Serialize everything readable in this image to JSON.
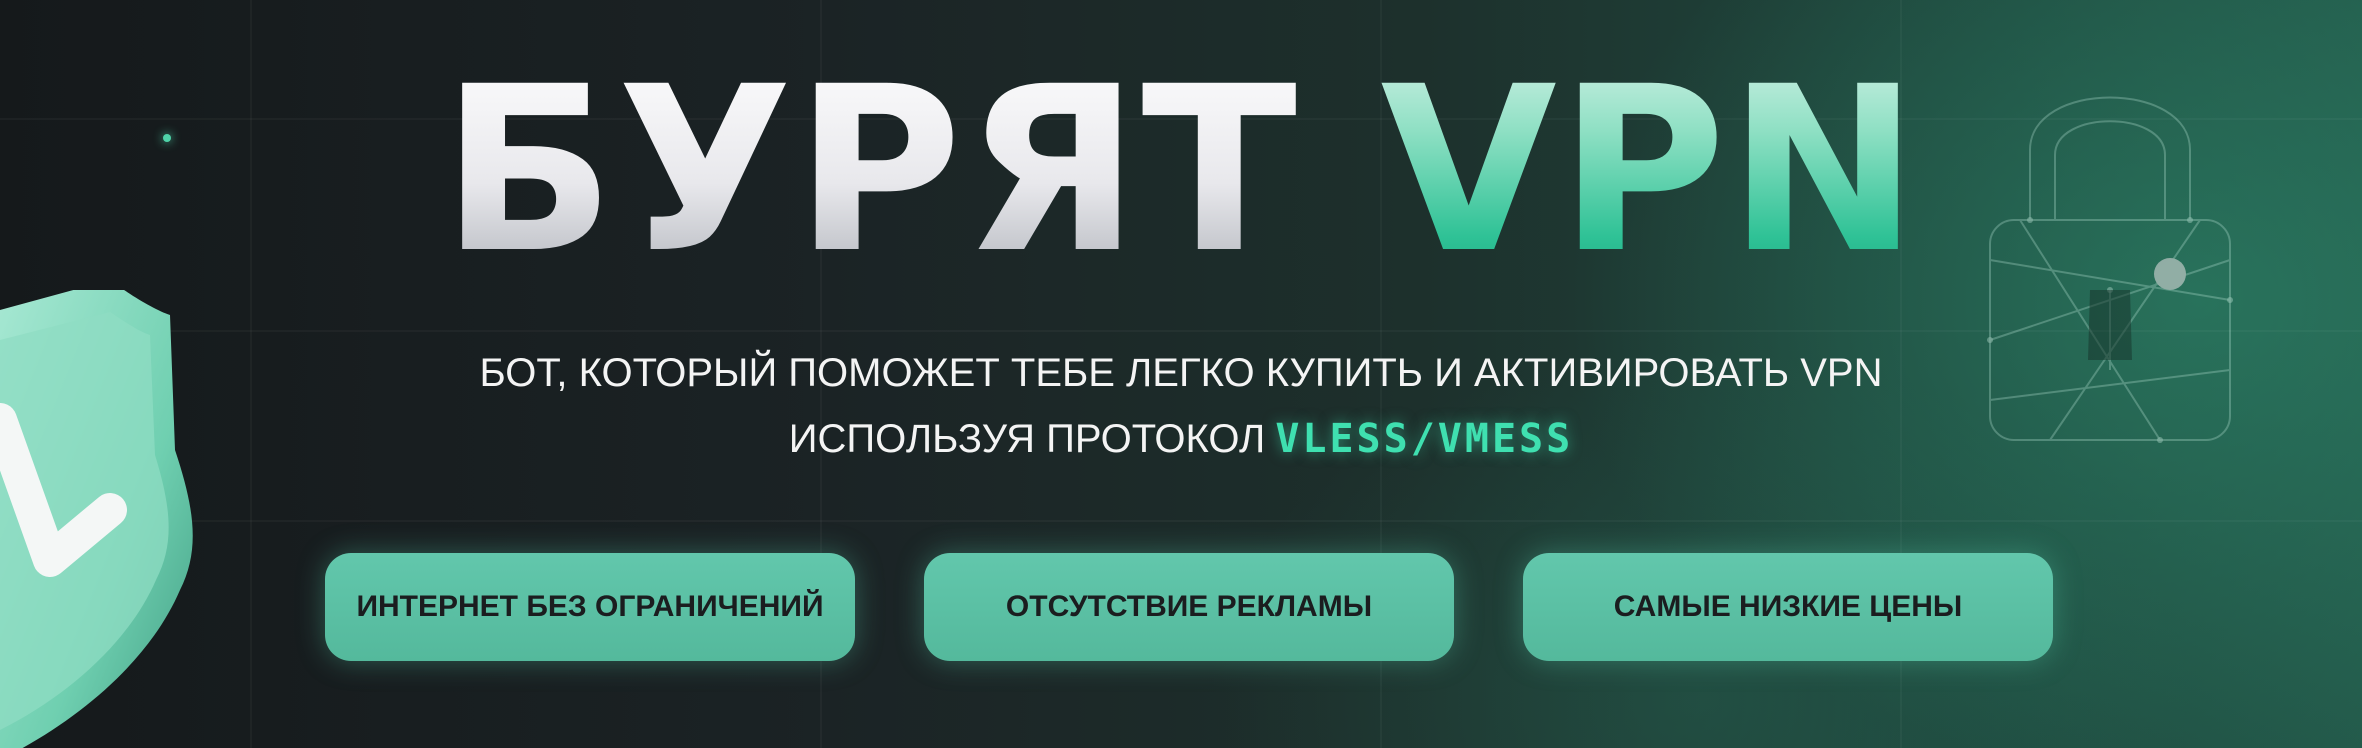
{
  "banner": {
    "title_part1": "БУРЯТ",
    "title_part2": "VPN",
    "subtitle_line1": "БОТ, КОТОРЫЙ ПОМОЖЕТ ТЕБЕ ЛЕГКО КУПИТЬ И АКТИВИРОВАТЬ VPN",
    "subtitle_line2": "ИСПОЛЬЗУЯ ПРОТОКОЛ",
    "protocol": "VLESS/VMESS"
  },
  "features": [
    {
      "label": "ИНТЕРНЕТ БЕЗ ОГРАНИЧЕНИЙ"
    },
    {
      "label": "ОТСУТСТВИЕ РЕКЛАМЫ"
    },
    {
      "label": "САМЫЕ НИЗКИЕ ЦЕНЫ"
    }
  ],
  "decor": {
    "left_icon": "shield-check-icon",
    "right_icon": "padlock-icon",
    "accent_color": "#5cd0ad",
    "button_color": "#5ec4a8",
    "background_color": "#15191b"
  }
}
